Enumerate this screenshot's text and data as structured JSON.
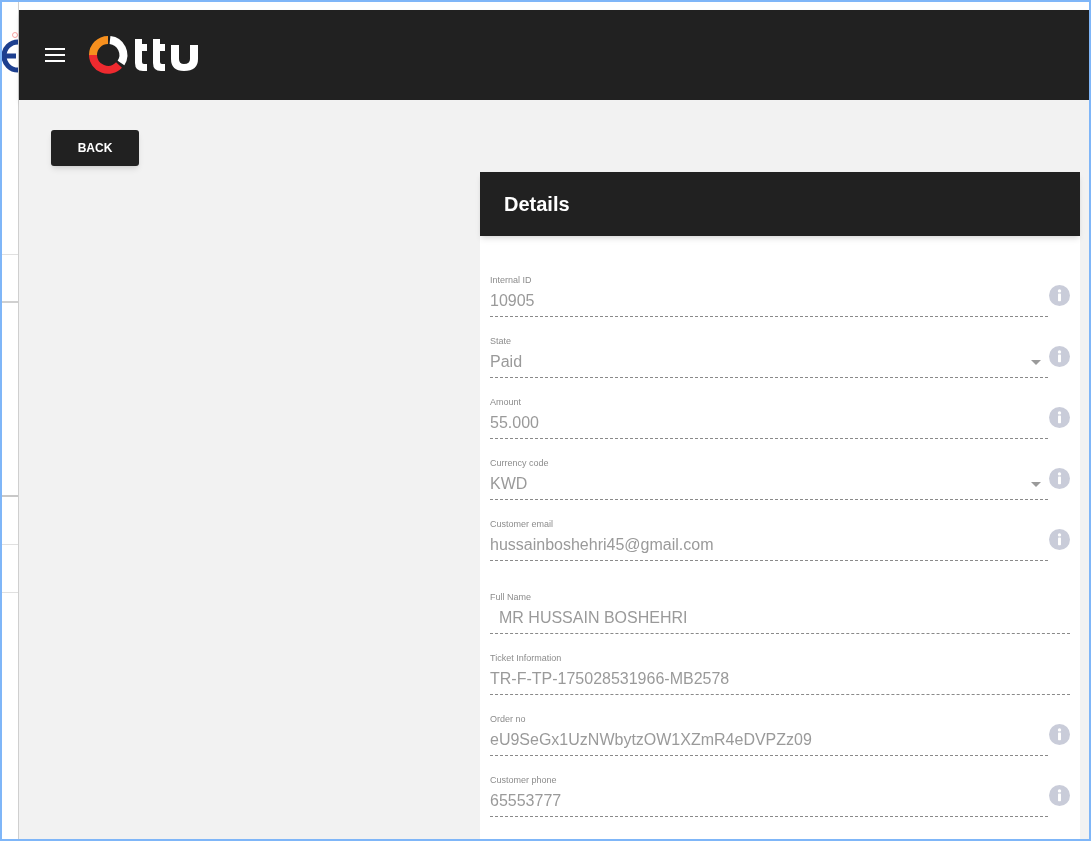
{
  "back_button": {
    "label": "BACK"
  },
  "details": {
    "title": "Details",
    "fields": [
      {
        "label": "Internal ID",
        "value": "10905",
        "kind": "text",
        "info": true
      },
      {
        "label": "State",
        "value": "Paid",
        "kind": "select",
        "info": true
      },
      {
        "label": "Amount",
        "value": "55.000",
        "kind": "text",
        "info": true
      },
      {
        "label": "Currency code",
        "value": "KWD",
        "kind": "select",
        "info": true
      },
      {
        "label": "Customer email",
        "value": "hussainboshehri45@gmail.com",
        "kind": "text",
        "info": true
      },
      {
        "label": "Full Name",
        "value": "MR HUSSAIN BOSHEHRI",
        "kind": "text",
        "info": false
      },
      {
        "label": "Ticket Information",
        "value": "TR-F-TP-175028531966-MB2578",
        "kind": "text",
        "info": false
      },
      {
        "label": "Order no",
        "value": "eU9SeGx1UzNWbytzOW1XZmR4eDVPZz09",
        "kind": "text",
        "info": true
      },
      {
        "label": "Customer phone",
        "value": "65553777",
        "kind": "text",
        "info": true
      }
    ]
  }
}
